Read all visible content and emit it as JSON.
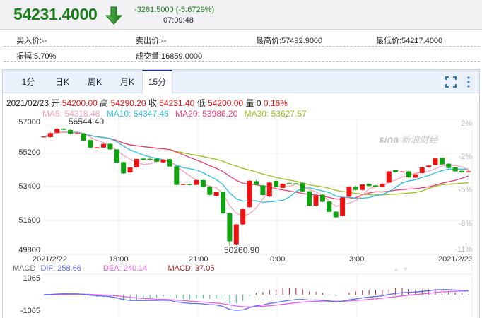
{
  "header": {
    "price": "54231.4000",
    "direction_icon": "arrow-down-icon",
    "change": "-3261.5000 (-5.6729%)",
    "time": "07:09:48"
  },
  "info": {
    "bid": "买入价:--",
    "ask": "卖出价:--",
    "high": "最高价:57492.9000",
    "low": "最低价:54217.4000",
    "amplitude": "振幅:5.70%",
    "volume": "成交量:16859.0000"
  },
  "tabs": [
    {
      "label": "1分"
    },
    {
      "label": "日K"
    },
    {
      "label": "周K"
    },
    {
      "label": "月K"
    },
    {
      "label": "15分",
      "active": true
    }
  ],
  "toolbar": {
    "fullscreen_icon": "fullscreen-icon",
    "more_icon": "more-vertical-icon"
  },
  "legend": {
    "date": "2021/02/23",
    "open_label": "开",
    "open": "54200.00",
    "high_label": "高",
    "high": "54290.20",
    "close_label": "收",
    "close": "54231.40",
    "low_label": "低",
    "low": "54200.00",
    "vol_label": "量",
    "vol": "0",
    "pct": "0.16%"
  },
  "ma": {
    "ma5": "MA5: 54318.48",
    "ma10": "MA10: 54347.46",
    "ma20": "MA20: 53986.20",
    "ma30": "MA30: 53627.57"
  },
  "watermark": "新浪财经",
  "macd_legend": {
    "title": "MACD",
    "dif": "DIF: 258.66",
    "dea": "DEA: 240.14",
    "macd": "MACD: 37.05"
  },
  "colors": {
    "up": "#ee1111",
    "down": "#0fa30f",
    "ma5": "#f7a3b9",
    "ma10": "#29bfe0",
    "ma20": "#ef3a72",
    "ma30": "#99c11c",
    "dif": "#5b6cf5",
    "dea": "#e65de6",
    "macd_up": "#b22222",
    "macd_down": "#2bbf8c"
  },
  "chart_data": {
    "type": "candlestick",
    "interval": "15分",
    "y_ticks": [
      "57000",
      "55200",
      "53400",
      "51600",
      "49800"
    ],
    "ylim": [
      49800,
      57000
    ],
    "pct_ticks": [
      "2%",
      "-2%",
      "-5%",
      "-8%",
      "-11%"
    ],
    "x_ticks": [
      "2021/2/22",
      "18:00",
      "21:00",
      "0:00",
      "3:00",
      "2021/2/23"
    ],
    "max_label": "56544.40",
    "min_label": "50260.90",
    "macd_ticks": [
      "1065",
      "-1065"
    ],
    "candles": [
      [
        56060,
        56110,
        56040,
        56090
      ],
      [
        56060,
        56300,
        56040,
        56270
      ],
      [
        56290,
        56544.4,
        56260,
        56500
      ],
      [
        56500,
        56544.4,
        56420,
        56450
      ],
      [
        56440,
        56480,
        56220,
        56240
      ],
      [
        56230,
        56280,
        56200,
        56260
      ],
      [
        56250,
        56270,
        55850,
        55870
      ],
      [
        55900,
        55930,
        55450,
        55500
      ],
      [
        55480,
        55530,
        55460,
        55510
      ],
      [
        55500,
        55710,
        55490,
        55690
      ],
      [
        55700,
        55730,
        55380,
        55400
      ],
      [
        55400,
        55420,
        54690,
        54700
      ],
      [
        54720,
        54740,
        54100,
        54120
      ],
      [
        54170,
        54460,
        54150,
        54440
      ],
      [
        54440,
        54900,
        54430,
        54890
      ],
      [
        54910,
        54930,
        54800,
        54850
      ],
      [
        54900,
        54920,
        54820,
        54860
      ],
      [
        54900,
        54930,
        54730,
        54750
      ],
      [
        54710,
        54870,
        54690,
        54860
      ],
      [
        54880,
        54920,
        54470,
        54490
      ],
      [
        54500,
        54520,
        53490,
        53510
      ],
      [
        53520,
        53570,
        53500,
        53550
      ],
      [
        53550,
        53570,
        53480,
        53500
      ],
      [
        53510,
        53780,
        53500,
        53760
      ],
      [
        53760,
        53780,
        53390,
        53410
      ],
      [
        53420,
        53440,
        52950,
        52980
      ],
      [
        52920,
        53140,
        52890,
        53120
      ],
      [
        53130,
        53160,
        51960,
        51980
      ],
      [
        51990,
        52010,
        50260.9,
        50500
      ],
      [
        50350,
        51420,
        50300,
        51400
      ],
      [
        51400,
        52230,
        51380,
        52210
      ],
      [
        52320,
        53750,
        52300,
        53730
      ],
      [
        53700,
        53760,
        53490,
        53510
      ],
      [
        53480,
        53500,
        52940,
        52970
      ],
      [
        52890,
        53650,
        52860,
        53630
      ],
      [
        53720,
        53740,
        53370,
        53390
      ],
      [
        53350,
        53590,
        53330,
        53570
      ],
      [
        53600,
        53620,
        53560,
        53580
      ],
      [
        53590,
        53610,
        53560,
        53575
      ],
      [
        53600,
        53620,
        53140,
        53160
      ],
      [
        53170,
        53190,
        52380,
        52400
      ],
      [
        52400,
        52980,
        52380,
        52960
      ],
      [
        52980,
        53010,
        52590,
        52610
      ],
      [
        52620,
        52640,
        52050,
        52070
      ],
      [
        52080,
        52110,
        51760,
        51780
      ],
      [
        51850,
        52860,
        51830,
        52840
      ],
      [
        52880,
        53440,
        52860,
        53420
      ],
      [
        53420,
        53450,
        53220,
        53240
      ],
      [
        53240,
        53550,
        53220,
        53530
      ],
      [
        53560,
        53590,
        53430,
        53450
      ],
      [
        53480,
        53500,
        53400,
        53420
      ],
      [
        53400,
        53600,
        53380,
        53570
      ],
      [
        53630,
        54250,
        53610,
        54230
      ],
      [
        54300,
        54320,
        54170,
        54190
      ],
      [
        54200,
        54240,
        54190,
        54220
      ],
      [
        54230,
        54250,
        53880,
        53910
      ],
      [
        53890,
        54090,
        53870,
        54070
      ],
      [
        54140,
        54460,
        54120,
        54440
      ],
      [
        54450,
        54560,
        54430,
        54540
      ],
      [
        54570,
        54940,
        54560,
        54920
      ],
      [
        54950,
        54970,
        54580,
        54600
      ],
      [
        54640,
        54660,
        54390,
        54410
      ],
      [
        54440,
        54460,
        54210,
        54230
      ],
      [
        54260,
        54280,
        54120,
        54180
      ],
      [
        54200,
        54290.2,
        54200,
        54231.4
      ]
    ]
  }
}
